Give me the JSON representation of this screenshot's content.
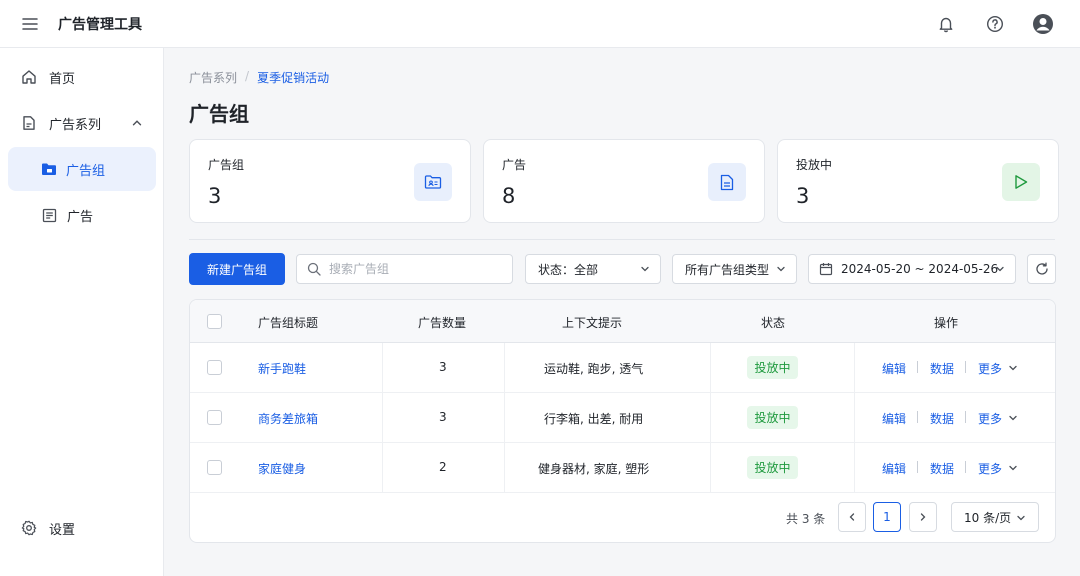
{
  "app": {
    "title": "广告管理工具"
  },
  "topbar": {
    "icons": [
      "menu-icon",
      "bell-icon",
      "help-icon",
      "user-avatar-icon"
    ]
  },
  "sidebar": {
    "items": [
      {
        "label": "首页",
        "icon": "home-icon"
      },
      {
        "label": "广告系列",
        "icon": "campaign-icon"
      },
      {
        "label": "广告组",
        "icon": "folder-icon"
      },
      {
        "label": "广告",
        "icon": "ad-doc-icon"
      }
    ],
    "settings_label": "设置"
  },
  "breadcrumb": {
    "parent": "广告系列",
    "separator": "/",
    "current": "夏季促销活动"
  },
  "page": {
    "title": "广告组"
  },
  "stats": [
    {
      "label": "广告组",
      "value": "3",
      "icon": "ad-group-icon",
      "color": "#e8effc"
    },
    {
      "label": "广告",
      "value": "8",
      "icon": "document-icon",
      "color": "#e8effc"
    },
    {
      "label": "投放中",
      "value": "3",
      "icon": "play-icon",
      "color": "#e3f5e6"
    }
  ],
  "toolbar": {
    "new_button": "新建广告组",
    "search_placeholder": "搜索广告组",
    "status_filter": "状态：全部",
    "type_filter": "所有广告组类型",
    "date_range": "2024-05-20 ~ 2024-05-26"
  },
  "table": {
    "headers": [
      "广告组标题",
      "广告数量",
      "上下文提示",
      "状态",
      "操作"
    ],
    "rows": [
      {
        "title": "新手跑鞋",
        "count": "3",
        "hints": "运动鞋, 跑步, 透气",
        "status": "投放中"
      },
      {
        "title": "商务差旅箱",
        "count": "3",
        "hints": "行李箱, 出差, 耐用",
        "status": "投放中"
      },
      {
        "title": "家庭健身",
        "count": "2",
        "hints": "健身器材, 家庭, 塑形",
        "status": "投放中"
      }
    ],
    "actions": {
      "edit": "编辑",
      "data": "数据",
      "more": "更多"
    }
  },
  "pagination": {
    "total": "共 3 条",
    "current_page": "1",
    "page_size": "10 条/页"
  },
  "colors": {
    "primary": "#1a5ee4",
    "success": "#1f9a3e",
    "success_bg": "#e6f7ea"
  }
}
